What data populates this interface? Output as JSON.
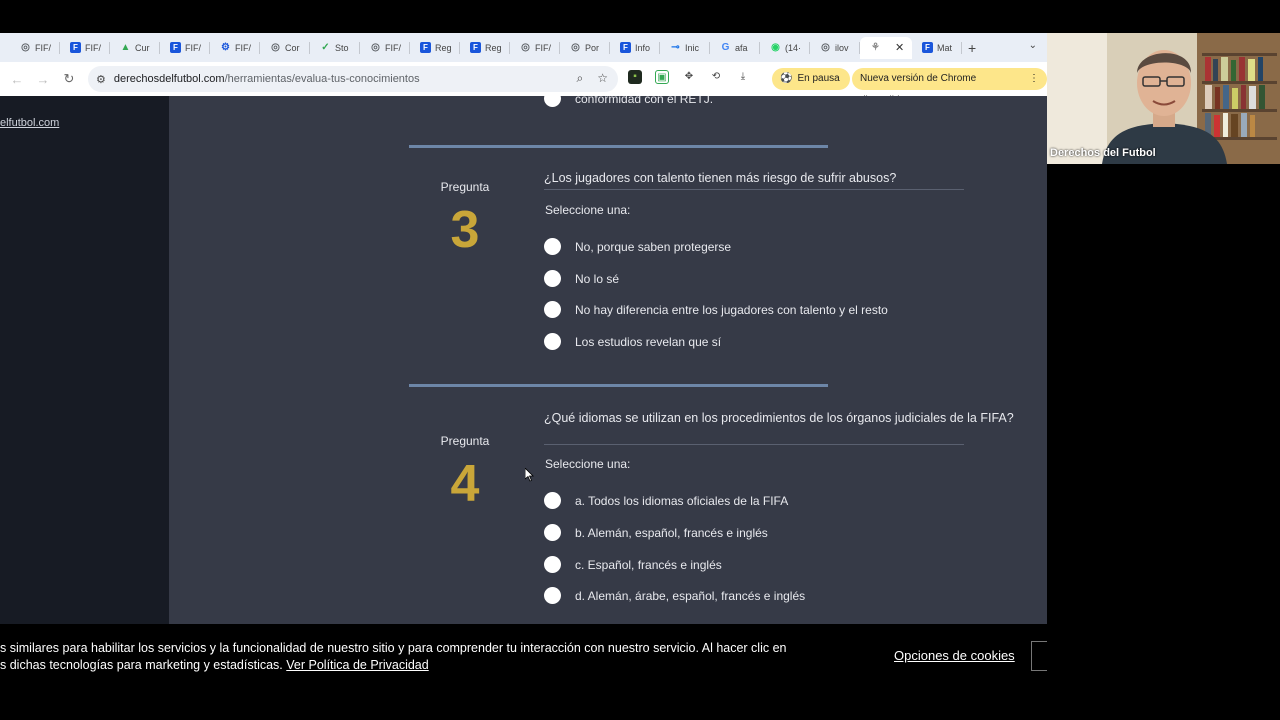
{
  "browser": {
    "tabs": [
      {
        "label": "FIF/",
        "icon": "globe-icon",
        "color": "#5f6368"
      },
      {
        "label": "FIF/",
        "icon": "f-icon",
        "color": "#1a56db"
      },
      {
        "label": "Cur",
        "icon": "drive-icon",
        "color": "#34a853"
      },
      {
        "label": "FIF/",
        "icon": "f-icon",
        "color": "#1a56db"
      },
      {
        "label": "FIF/",
        "icon": "settings-icon",
        "color": "#1a56db"
      },
      {
        "label": "Cor",
        "icon": "globe-icon",
        "color": "#5f6368"
      },
      {
        "label": "Sto",
        "icon": "check-icon",
        "color": "#34a853"
      },
      {
        "label": "FIF/",
        "icon": "globe-icon",
        "color": "#5f6368"
      },
      {
        "label": "Reg",
        "icon": "f-icon",
        "color": "#1a56db"
      },
      {
        "label": "Reg",
        "icon": "f-icon",
        "color": "#1a56db"
      },
      {
        "label": "FIF/",
        "icon": "globe-icon",
        "color": "#5f6368"
      },
      {
        "label": "Por",
        "icon": "globe-icon",
        "color": "#5f6368"
      },
      {
        "label": "Info",
        "icon": "f-icon",
        "color": "#1a56db"
      },
      {
        "label": "Inic",
        "icon": "link-icon",
        "color": "#1a73e8"
      },
      {
        "label": "afa",
        "icon": "google-icon",
        "color": "#4285f4"
      },
      {
        "label": "(14·",
        "icon": "whatsapp-icon",
        "color": "#25d366"
      },
      {
        "label": "ilov",
        "icon": "globe-icon",
        "color": "#5f6368"
      },
      {
        "label": "",
        "icon": "active-site-icon",
        "color": "#888888"
      },
      {
        "label": "Mat",
        "icon": "f-icon",
        "color": "#1a56db"
      }
    ],
    "url_domain": "derechosdelfutbol.com",
    "url_path": "/herramientas/evalua-tus-conocimientos",
    "paused_label": "En pausa",
    "update_label": "Nueva versión de Chrome disponible"
  },
  "page": {
    "left_link": "elfutbol.com",
    "prev_answer_tail": "conformidad con el RETJ.",
    "questions": [
      {
        "label": "Pregunta",
        "number": "3",
        "title": "¿Los jugadores con talento tienen más riesgo de sufrir abusos?",
        "select_one": "Seleccione una:",
        "options": [
          "No, porque saben protegerse",
          "No lo sé",
          "No hay diferencia entre los jugadores con talento y el resto",
          "Los estudios revelan que sí"
        ]
      },
      {
        "label": "Pregunta",
        "number": "4",
        "title": "¿Qué idiomas se utilizan en los procedimientos de los órganos judiciales de la FIFA?",
        "select_one": "Seleccione una:",
        "options": [
          "a. Todos los idiomas oficiales de la FIFA",
          "b. Alemán, español, francés e inglés",
          "c. Español, francés e inglés",
          "d. Alemán, árabe, español, francés e inglés"
        ]
      }
    ]
  },
  "cookie": {
    "line1": "s similares para habilitar los servicios y la funcionalidad de nuestro sitio y para comprender tu interacción con nuestro servicio. Al hacer clic en",
    "line2": "s dichas tecnologías para marketing y estadísticas. ",
    "privacy_link": "Ver Política de Privacidad",
    "options_link": "Opciones de cookies"
  },
  "webcam": {
    "name": "Derechos del Futbol"
  },
  "colors": {
    "accent_number": "#c9a639",
    "page_bg": "#363a47",
    "separator": "#6d86a8"
  }
}
